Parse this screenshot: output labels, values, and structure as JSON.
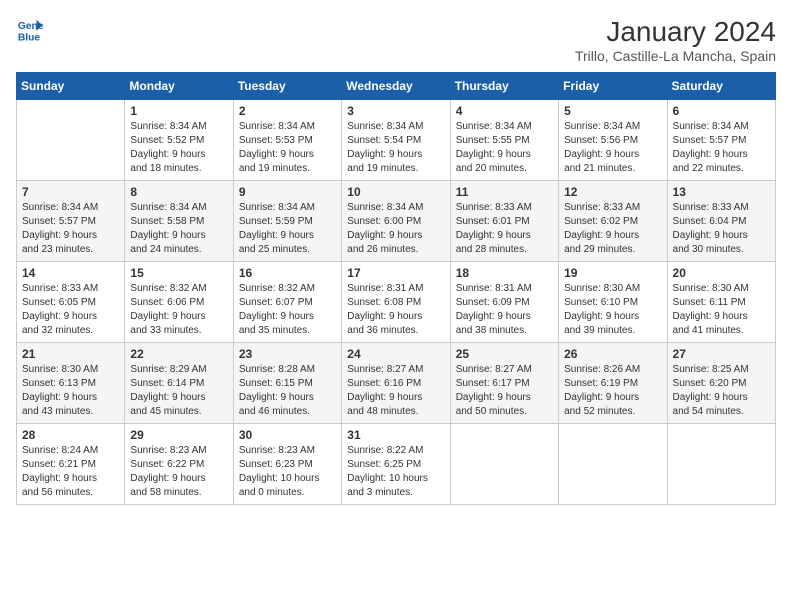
{
  "header": {
    "logo_line1": "General",
    "logo_line2": "Blue",
    "month_title": "January 2024",
    "subtitle": "Trillo, Castille-La Mancha, Spain"
  },
  "days_of_week": [
    "Sunday",
    "Monday",
    "Tuesday",
    "Wednesday",
    "Thursday",
    "Friday",
    "Saturday"
  ],
  "weeks": [
    [
      {
        "day": "",
        "info": ""
      },
      {
        "day": "1",
        "info": "Sunrise: 8:34 AM\nSunset: 5:52 PM\nDaylight: 9 hours\nand 18 minutes."
      },
      {
        "day": "2",
        "info": "Sunrise: 8:34 AM\nSunset: 5:53 PM\nDaylight: 9 hours\nand 19 minutes."
      },
      {
        "day": "3",
        "info": "Sunrise: 8:34 AM\nSunset: 5:54 PM\nDaylight: 9 hours\nand 19 minutes."
      },
      {
        "day": "4",
        "info": "Sunrise: 8:34 AM\nSunset: 5:55 PM\nDaylight: 9 hours\nand 20 minutes."
      },
      {
        "day": "5",
        "info": "Sunrise: 8:34 AM\nSunset: 5:56 PM\nDaylight: 9 hours\nand 21 minutes."
      },
      {
        "day": "6",
        "info": "Sunrise: 8:34 AM\nSunset: 5:57 PM\nDaylight: 9 hours\nand 22 minutes."
      }
    ],
    [
      {
        "day": "7",
        "info": ""
      },
      {
        "day": "8",
        "info": "Sunrise: 8:34 AM\nSunset: 5:58 PM\nDaylight: 9 hours\nand 24 minutes."
      },
      {
        "day": "9",
        "info": "Sunrise: 8:34 AM\nSunset: 5:59 PM\nDaylight: 9 hours\nand 25 minutes."
      },
      {
        "day": "10",
        "info": "Sunrise: 8:34 AM\nSunset: 6:00 PM\nDaylight: 9 hours\nand 26 minutes."
      },
      {
        "day": "11",
        "info": "Sunrise: 8:33 AM\nSunset: 6:01 PM\nDaylight: 9 hours\nand 28 minutes."
      },
      {
        "day": "12",
        "info": "Sunrise: 8:33 AM\nSunset: 6:02 PM\nDaylight: 9 hours\nand 29 minutes."
      },
      {
        "day": "13",
        "info": "Sunrise: 8:33 AM\nSunset: 6:04 PM\nDaylight: 9 hours\nand 30 minutes."
      }
    ],
    [
      {
        "day": "14",
        "info": ""
      },
      {
        "day": "15",
        "info": "Sunrise: 8:32 AM\nSunset: 6:06 PM\nDaylight: 9 hours\nand 33 minutes."
      },
      {
        "day": "16",
        "info": "Sunrise: 8:32 AM\nSunset: 6:07 PM\nDaylight: 9 hours\nand 35 minutes."
      },
      {
        "day": "17",
        "info": "Sunrise: 8:31 AM\nSunset: 6:08 PM\nDaylight: 9 hours\nand 36 minutes."
      },
      {
        "day": "18",
        "info": "Sunrise: 8:31 AM\nSunset: 6:09 PM\nDaylight: 9 hours\nand 38 minutes."
      },
      {
        "day": "19",
        "info": "Sunrise: 8:30 AM\nSunset: 6:10 PM\nDaylight: 9 hours\nand 39 minutes."
      },
      {
        "day": "20",
        "info": "Sunrise: 8:30 AM\nSunset: 6:11 PM\nDaylight: 9 hours\nand 41 minutes."
      }
    ],
    [
      {
        "day": "21",
        "info": ""
      },
      {
        "day": "22",
        "info": "Sunrise: 8:29 AM\nSunset: 6:14 PM\nDaylight: 9 hours\nand 45 minutes."
      },
      {
        "day": "23",
        "info": "Sunrise: 8:28 AM\nSunset: 6:15 PM\nDaylight: 9 hours\nand 46 minutes."
      },
      {
        "day": "24",
        "info": "Sunrise: 8:27 AM\nSunset: 6:16 PM\nDaylight: 9 hours\nand 48 minutes."
      },
      {
        "day": "25",
        "info": "Sunrise: 8:27 AM\nSunset: 6:17 PM\nDaylight: 9 hours\nand 50 minutes."
      },
      {
        "day": "26",
        "info": "Sunrise: 8:26 AM\nSunset: 6:19 PM\nDaylight: 9 hours\nand 52 minutes."
      },
      {
        "day": "27",
        "info": "Sunrise: 8:25 AM\nSunset: 6:20 PM\nDaylight: 9 hours\nand 54 minutes."
      }
    ],
    [
      {
        "day": "28",
        "info": "Sunrise: 8:24 AM\nSunset: 6:21 PM\nDaylight: 9 hours\nand 56 minutes."
      },
      {
        "day": "29",
        "info": "Sunrise: 8:23 AM\nSunset: 6:22 PM\nDaylight: 9 hours\nand 58 minutes."
      },
      {
        "day": "30",
        "info": "Sunrise: 8:23 AM\nSunset: 6:23 PM\nDaylight: 10 hours\nand 0 minutes."
      },
      {
        "day": "31",
        "info": "Sunrise: 8:22 AM\nSunset: 6:25 PM\nDaylight: 10 hours\nand 3 minutes."
      },
      {
        "day": "",
        "info": ""
      },
      {
        "day": "",
        "info": ""
      },
      {
        "day": "",
        "info": ""
      }
    ]
  ],
  "week0_day7_info": "Sunrise: 8:34 AM\nSunset: 5:57 PM\nDaylight: 9 hours\nand 23 minutes.",
  "week1_day0_info": "Sunrise: 8:34 AM\nSunset: 5:57 PM\nDaylight: 9 hours\nand 23 minutes.",
  "week2_day0_info": "Sunrise: 8:33 AM\nSunset: 6:05 PM\nDaylight: 9 hours\nand 32 minutes.",
  "week3_day0_info": "Sunrise: 8:30 AM\nSunset: 6:13 PM\nDaylight: 9 hours\nand 43 minutes."
}
